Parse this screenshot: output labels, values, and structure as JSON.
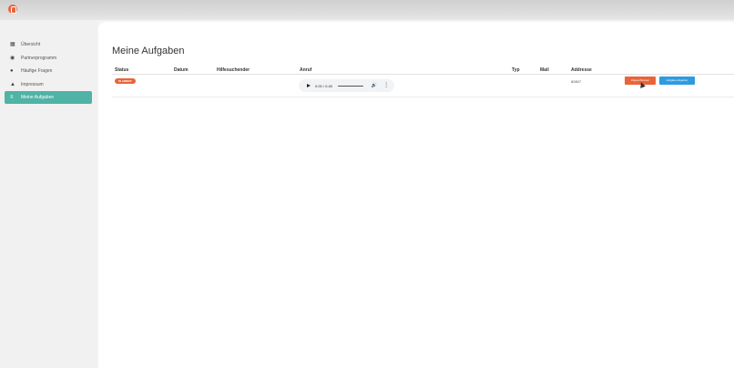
{
  "sidebar": {
    "items": [
      {
        "label": "Übersicht",
        "icon": "map-icon",
        "active": false
      },
      {
        "label": "Partnerprogramm",
        "icon": "eye-icon",
        "active": false
      },
      {
        "label": "Häufige Fragen",
        "icon": "question-icon",
        "active": false
      },
      {
        "label": "Impressum",
        "icon": "person-icon",
        "active": false
      },
      {
        "label": "Meine Aufgaben",
        "icon": "list-icon",
        "active": true
      }
    ]
  },
  "main": {
    "title": "Meine Aufgaben",
    "columns": [
      "Status",
      "Datum",
      "Hilfesuchender",
      "Anruf",
      "Typ",
      "Mail",
      "Addresse"
    ],
    "rows": [
      {
        "status": "IN ARBEIT",
        "audio_time": "0:00 / 0:45",
        "address": "80807",
        "btn_primary": "Abgeschlossen",
        "btn_secondary": "Aufgabe abgeben"
      }
    ]
  },
  "colors": {
    "accent": "#4fb3a5",
    "status_badge": "#e8643a",
    "button_orange": "#e8643a",
    "button_blue": "#2e9be0"
  }
}
